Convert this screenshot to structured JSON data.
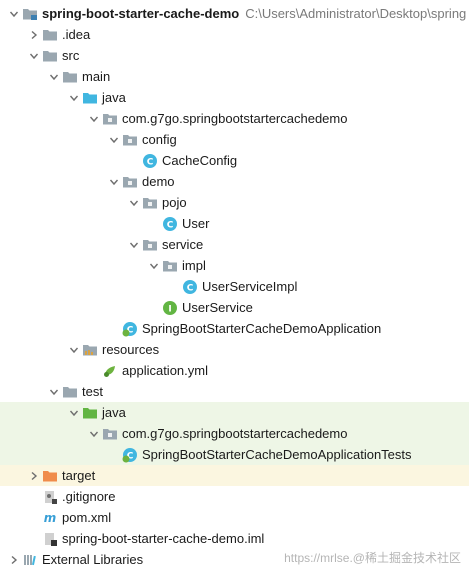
{
  "project_path": "C:\\Users\\Administrator\\Desktop\\spring",
  "watermark": "https://mrlse.@稀土掘金技术社区",
  "tree": [
    {
      "label": "spring-boot-starter-cache-demo",
      "icon": "module-folder-icon",
      "arrow": "expanded",
      "level": 0,
      "bold": true,
      "path": true,
      "zone": ""
    },
    {
      "label": ".idea",
      "icon": "folder-icon",
      "arrow": "collapsed",
      "level": 1,
      "zone": ""
    },
    {
      "label": "src",
      "icon": "folder-icon",
      "arrow": "expanded",
      "level": 1,
      "zone": ""
    },
    {
      "label": "main",
      "icon": "folder-icon",
      "arrow": "expanded",
      "level": 2,
      "zone": ""
    },
    {
      "label": "java",
      "icon": "source-folder-icon",
      "arrow": "expanded",
      "level": 3,
      "zone": ""
    },
    {
      "label": "com.g7go.springbootstartercachedemo",
      "icon": "package-icon",
      "arrow": "expanded",
      "level": 4,
      "zone": ""
    },
    {
      "label": "config",
      "icon": "package-icon",
      "arrow": "expanded",
      "level": 5,
      "zone": ""
    },
    {
      "label": "CacheConfig",
      "icon": "class-icon",
      "arrow": "none",
      "level": 6,
      "zone": ""
    },
    {
      "label": "demo",
      "icon": "package-icon",
      "arrow": "expanded",
      "level": 5,
      "zone": ""
    },
    {
      "label": "pojo",
      "icon": "package-icon",
      "arrow": "expanded",
      "level": 6,
      "zone": ""
    },
    {
      "label": "User",
      "icon": "class-icon",
      "arrow": "none",
      "level": 7,
      "zone": ""
    },
    {
      "label": "service",
      "icon": "package-icon",
      "arrow": "expanded",
      "level": 6,
      "zone": ""
    },
    {
      "label": "impl",
      "icon": "package-icon",
      "arrow": "expanded",
      "level": 7,
      "zone": ""
    },
    {
      "label": "UserServiceImpl",
      "icon": "class-icon",
      "arrow": "none",
      "level": 8,
      "zone": ""
    },
    {
      "label": "UserService",
      "icon": "interface-icon",
      "arrow": "none",
      "level": 7,
      "zone": ""
    },
    {
      "label": "SpringBootStarterCacheDemoApplication",
      "icon": "spring-class-icon",
      "arrow": "none",
      "level": 5,
      "zone": ""
    },
    {
      "label": "resources",
      "icon": "resources-folder-icon",
      "arrow": "expanded",
      "level": 3,
      "zone": ""
    },
    {
      "label": "application.yml",
      "icon": "yml-file-icon",
      "arrow": "none",
      "level": 4,
      "zone": ""
    },
    {
      "label": "test",
      "icon": "folder-icon",
      "arrow": "expanded",
      "level": 2,
      "zone": ""
    },
    {
      "label": "java",
      "icon": "test-folder-icon",
      "arrow": "expanded",
      "level": 3,
      "zone": "test"
    },
    {
      "label": "com.g7go.springbootstartercachedemo",
      "icon": "package-icon",
      "arrow": "expanded",
      "level": 4,
      "zone": "test"
    },
    {
      "label": "SpringBootStarterCacheDemoApplicationTests",
      "icon": "spring-class-icon",
      "arrow": "none",
      "level": 5,
      "zone": "test"
    },
    {
      "label": "target",
      "icon": "excluded-folder-icon",
      "arrow": "collapsed",
      "level": 1,
      "zone": "excluded"
    },
    {
      "label": ".gitignore",
      "icon": "gitignore-file-icon",
      "arrow": "none",
      "level": 1,
      "zone": ""
    },
    {
      "label": "pom.xml",
      "icon": "maven-file-icon",
      "arrow": "none",
      "level": 1,
      "zone": ""
    },
    {
      "label": "spring-boot-starter-cache-demo.iml",
      "icon": "iml-file-icon",
      "arrow": "none",
      "level": 1,
      "zone": ""
    },
    {
      "label": "External Libraries",
      "icon": "libraries-icon",
      "arrow": "collapsed",
      "level": 0,
      "zone": ""
    }
  ]
}
